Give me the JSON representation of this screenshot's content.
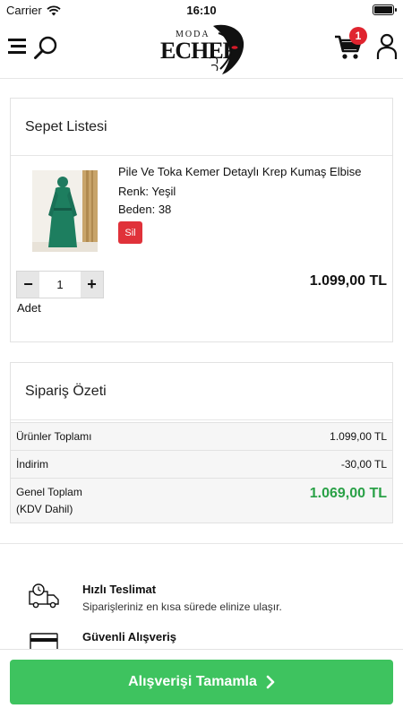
{
  "status": {
    "carrier": "Carrier",
    "time": "16:10"
  },
  "header": {
    "logo_top": "MODA",
    "logo_main": "ECHER",
    "cart_count": "1",
    "icons": [
      "menu-icon",
      "search-icon",
      "cart-icon",
      "user-icon"
    ]
  },
  "cart": {
    "title": "Sepet Listesi",
    "item": {
      "name": "Pile Ve Toka Kemer Detaylı Krep Kumaş Elbise",
      "color_line": "Renk: Yeşil",
      "size_line": "Beden: 38",
      "delete_label": "Sil",
      "quantity": "1",
      "quantity_label": "Adet",
      "price": "1.099,00 TL"
    }
  },
  "summary": {
    "title": "Sipariş Özeti",
    "rows": [
      {
        "label": "Ürünler Toplamı",
        "value": "1.099,00 TL"
      },
      {
        "label": "İndirim",
        "value": "-30,00 TL"
      }
    ],
    "grand_label_1": "Genel Toplam",
    "grand_label_2": "(KDV Dahil)",
    "grand_value": "1.069,00 TL"
  },
  "features": [
    {
      "title": "Hızlı Teslimat",
      "desc": "Siparişleriniz en kısa sürede elinize ulaşır.",
      "icon": "delivery-truck-icon"
    },
    {
      "title": "Güvenli Alışveriş",
      "desc": "",
      "icon": "credit-card-icon"
    }
  ],
  "checkout": {
    "label": "Alışverişi Tamamla"
  },
  "colors": {
    "accent_green": "#3ec35f",
    "price_green": "#2aa147",
    "danger_red": "#e0323a",
    "badge_red": "#e0242f"
  }
}
